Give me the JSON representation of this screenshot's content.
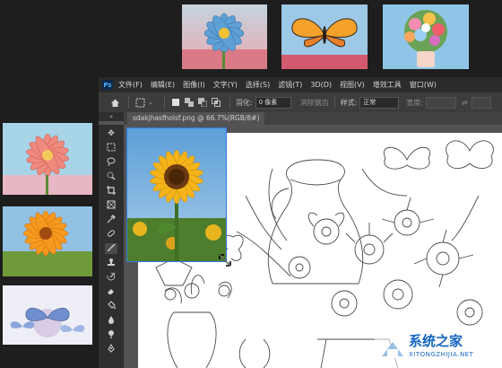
{
  "menubar": {
    "app_icon": "Ps",
    "items": [
      "文件(F)",
      "编辑(E)",
      "图像(I)",
      "文字(Y)",
      "选择(S)",
      "滤镜(T)",
      "3D(D)",
      "视图(V)",
      "增效工具",
      "窗口(W)"
    ]
  },
  "options": {
    "feather_label": "羽化:",
    "feather_value": "0 像素",
    "antialias_label": "消除锯齿",
    "style_label": "样式:",
    "style_value": "正常",
    "width_label": "宽度:"
  },
  "document": {
    "tab_label": "sdakjhasfholsf.png @ 66.7%(RGB/8#)"
  },
  "toolbox": {
    "collapse_label": "»",
    "tools": [
      "move-icon",
      "marquee-icon",
      "lasso-icon",
      "quick-select-icon",
      "crop-icon",
      "frame-icon",
      "eyedropper-icon",
      "healing-icon",
      "brush-icon",
      "stamp-icon",
      "history-brush-icon",
      "eraser-icon",
      "bucket-icon",
      "blur-icon",
      "dodge-icon",
      "pen-icon"
    ]
  },
  "thumbnails": {
    "top": [
      "blue-daisy-image",
      "butterfly-image",
      "bouquet-image"
    ],
    "left": [
      "pink-daisy-image",
      "orange-gerbera-image",
      "blue-butterflies-image"
    ]
  },
  "canvas": {
    "dragged_image": "sunflower-image",
    "background": "line-art-vase-flowers"
  },
  "watermark": {
    "text": "系统之家",
    "url": "XITONGZHIJIA.NET"
  },
  "colors": {
    "app_bg": "#1e1e1e",
    "menubar_bg": "#2b2b2b",
    "options_bg": "#3c3c3c",
    "workspace_bg": "#535353",
    "canvas_bg": "#ffffff",
    "selection_blue": "#2f7de1"
  }
}
